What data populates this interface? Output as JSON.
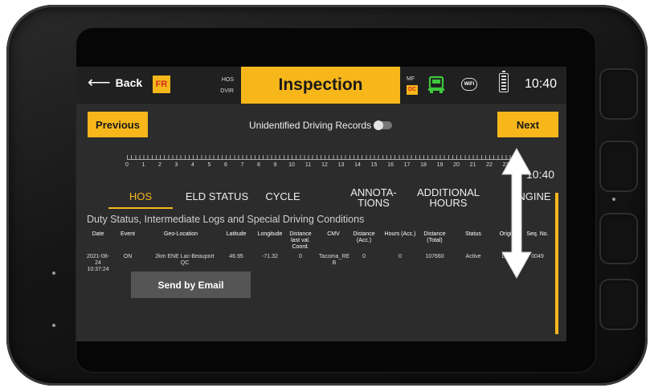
{
  "header": {
    "back_label": "Back",
    "lang_badge": "FR",
    "hos_label": "HOS",
    "dvir_label": "DVIR",
    "title": "Inspection",
    "mf_label": "MF",
    "dc_label": "DC",
    "wifi_label": "WiFi",
    "time": "10:40"
  },
  "toolbar": {
    "previous_label": "Previous",
    "next_label": "Next",
    "unidentified_label": "Unidentified Driving Records"
  },
  "ruler": {
    "hours": [
      "0",
      "1",
      "2",
      "3",
      "4",
      "5",
      "6",
      "7",
      "8",
      "9",
      "10",
      "11",
      "12",
      "13",
      "14",
      "15",
      "16",
      "17",
      "18",
      "19",
      "20",
      "21",
      "22",
      "23"
    ],
    "time_label": "10:40"
  },
  "tabs": [
    {
      "label": "HOS"
    },
    {
      "label": "ELD STATUS"
    },
    {
      "label": "CYCLE"
    },
    {
      "label_1": "ANNOTA-",
      "label_2": "TIONS"
    },
    {
      "label_1": "ADDITIONAL",
      "label_2": "HOURS"
    },
    {
      "label": "NGINE"
    }
  ],
  "section": {
    "title": "Duty Status, Intermediate Logs and Special Driving Conditions"
  },
  "table": {
    "columns": [
      {
        "l1": "Date"
      },
      {
        "l1": "Event"
      },
      {
        "l1": "Geo-Location"
      },
      {
        "l1": "Latitude"
      },
      {
        "l1": "Longitude"
      },
      {
        "l1": "Distance",
        "l2": "last val.",
        "l3": "Coord."
      },
      {
        "l1": "CMV"
      },
      {
        "l1": "Distance",
        "l2": "(Acc.)"
      },
      {
        "l1": "Hours (Acc.)"
      },
      {
        "l1": "Distance",
        "l2": "(Total)"
      },
      {
        "l1": "Status"
      },
      {
        "l1": "Origi"
      },
      {
        "l1": "Seq. No."
      }
    ],
    "rows": [
      {
        "date_l1": "2021-08-24",
        "date_l2": "10:37:24",
        "event": "ON",
        "geo_l1": "2km ENE Lac-Beauport",
        "geo_l2": "QC",
        "latitude": "46.95",
        "longitude": "-71.32",
        "dist_last": "0",
        "cmv_l1": "Tacoma_RE",
        "cmv_l2": "B",
        "dist_acc": "0",
        "hours_acc": "0",
        "dist_total": "107660",
        "status": "Active",
        "origin": "Dri",
        "seq": "0049"
      }
    ]
  },
  "actions": {
    "email_label": "Send by Email"
  },
  "colors": {
    "accent": "#f7b71b",
    "badge_text": "#d62b1f",
    "truck_green": "#3cc93c",
    "background": "#2c2c2c"
  }
}
